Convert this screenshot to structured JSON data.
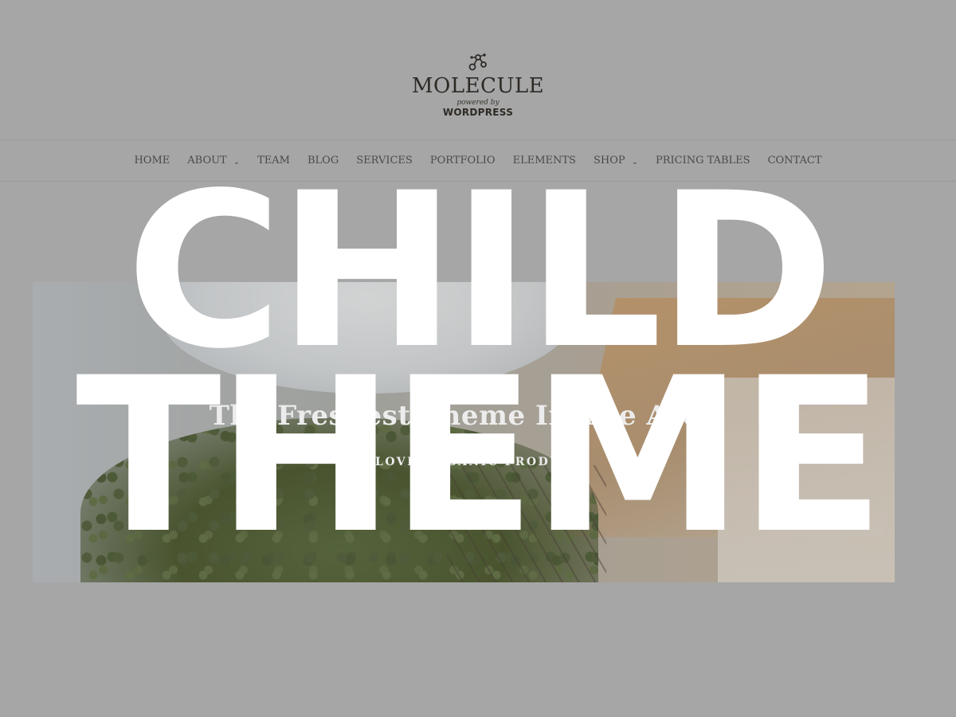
{
  "logo": {
    "title": "MOLECULE",
    "powered_by": "powered by",
    "platform": "WORDPRESS",
    "icon": "molecule-icon"
  },
  "nav": {
    "items": [
      {
        "label": "HOME"
      },
      {
        "label": "ABOUT",
        "has_dropdown": true
      },
      {
        "label": "TEAM"
      },
      {
        "label": "BLOG"
      },
      {
        "label": "SERVICES"
      },
      {
        "label": "PORTFOLIO"
      },
      {
        "label": "ELEMENTS"
      },
      {
        "label": "SHOP",
        "has_dropdown": true
      },
      {
        "label": "PRICING TABLES"
      },
      {
        "label": "CONTACT"
      }
    ],
    "dropdown_icon": "chevron-down-icon"
  },
  "hero": {
    "title": "The Freshest Theme In The Area",
    "subtitle": "WE LOVE ORGANIC PRODUCE"
  },
  "overlay": {
    "line1": "CHILD",
    "line2": "THEME"
  },
  "colors": {
    "page_background": "#a6a6a6",
    "overlay_text": "#ffffff",
    "nav_text": "#4a4a4a",
    "logo_text": "#2e2a26"
  }
}
